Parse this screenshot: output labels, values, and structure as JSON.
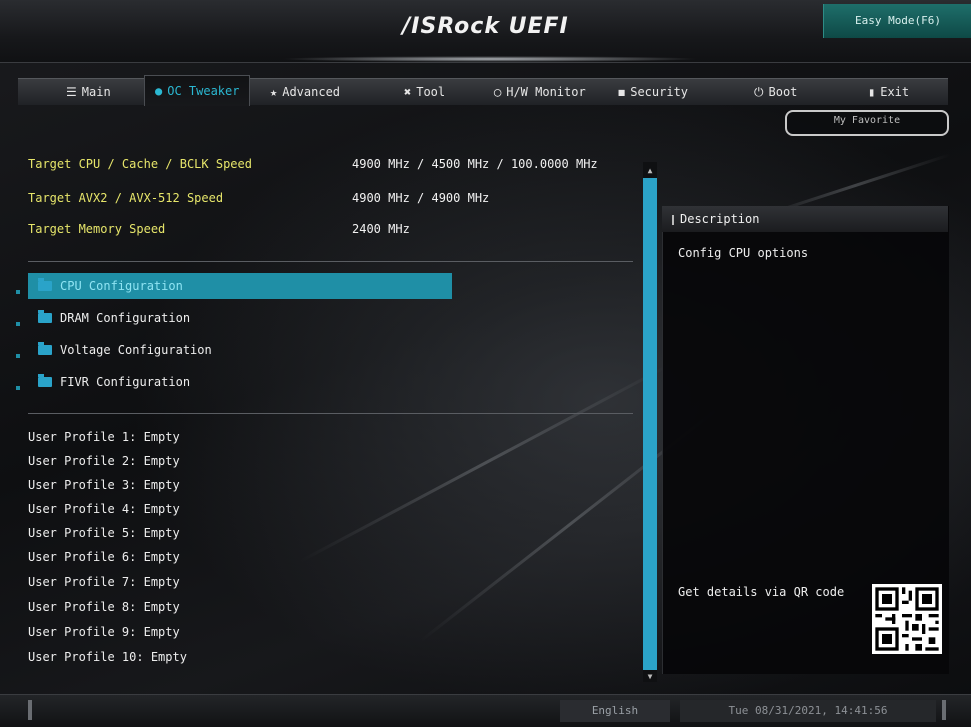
{
  "header": {
    "brand": "/ISRock UEFI",
    "easy_mode_label": "Easy Mode(F6)"
  },
  "tabs": [
    {
      "label": "Main",
      "icon": "list-icon"
    },
    {
      "label": "OC Tweaker",
      "icon": "flame-icon",
      "active": true
    },
    {
      "label": "Advanced",
      "icon": "star-icon"
    },
    {
      "label": "Tool",
      "icon": "tools-icon"
    },
    {
      "label": "H/W Monitor",
      "icon": "monitor-icon"
    },
    {
      "label": "Security",
      "icon": "shield-icon"
    },
    {
      "label": "Boot",
      "icon": "power-icon"
    },
    {
      "label": "Exit",
      "icon": "exit-icon"
    }
  ],
  "favorite_label": "My Favorite",
  "info": [
    {
      "label": "Target CPU / Cache / BCLK Speed",
      "value": "4900 MHz / 4500 MHz / 100.0000 MHz"
    },
    {
      "label": "Target AVX2 / AVX-512 Speed",
      "value": "4900 MHz / 4900 MHz"
    },
    {
      "label": "Target Memory Speed",
      "value": "2400 MHz"
    }
  ],
  "menu": [
    {
      "label": "CPU Configuration",
      "selected": true
    },
    {
      "label": "DRAM Configuration"
    },
    {
      "label": "Voltage Configuration"
    },
    {
      "label": "FIVR Configuration"
    }
  ],
  "profiles": [
    "User Profile 1: Empty",
    "User Profile 2: Empty",
    "User Profile 3: Empty",
    "User Profile 4: Empty",
    "User Profile 5: Empty",
    "User Profile 6: Empty",
    "User Profile 7: Empty",
    "User Profile 8: Empty",
    "User Profile 9: Empty",
    "User Profile 10: Empty"
  ],
  "description": {
    "title": "Description",
    "text": "Config CPU options",
    "qr_text": "Get details via QR code"
  },
  "footer": {
    "language": "English",
    "datetime": "Tue 08/31/2021, 14:41:56"
  },
  "colors": {
    "accent": "#2bb8d2",
    "info_label": "#e6e56a",
    "selected_bg": "#1f8fa6",
    "scroll_thumb": "#2ba3c8"
  }
}
